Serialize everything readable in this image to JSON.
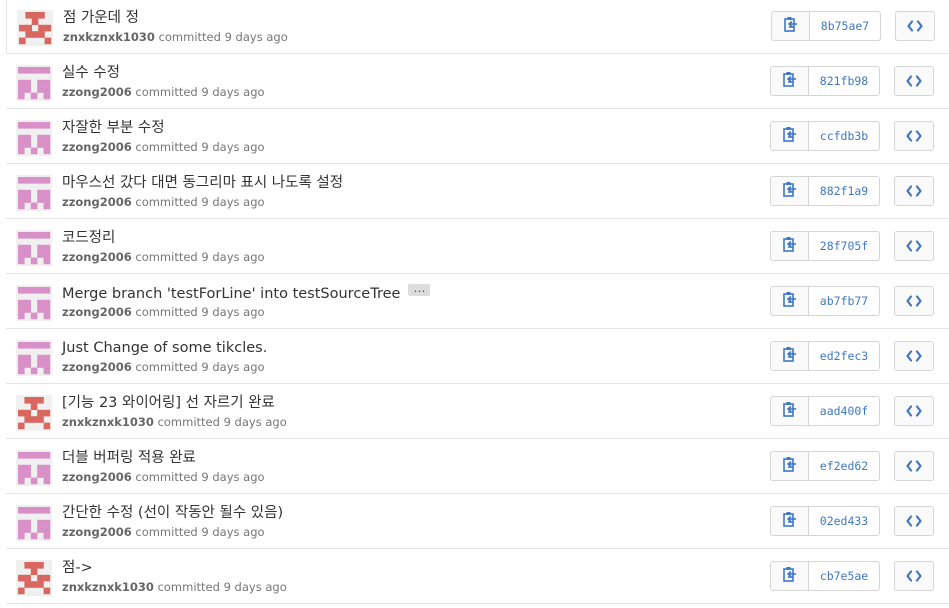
{
  "commits": [
    {
      "title": "점 가운데 정",
      "author": "znxkznxk1030",
      "time": "committed 9 days ago",
      "sha": "8b75ae7",
      "avatar": "red",
      "has_ellipsis": false
    },
    {
      "title": "실수 수정",
      "author": "zzong2006",
      "time": "committed 9 days ago",
      "sha": "821fb98",
      "avatar": "pink",
      "has_ellipsis": false
    },
    {
      "title": "자잘한 부분 수정",
      "author": "zzong2006",
      "time": "committed 9 days ago",
      "sha": "ccfdb3b",
      "avatar": "pink",
      "has_ellipsis": false
    },
    {
      "title": "마우스선 갔다 대면 동그리마 표시 나도록 설정",
      "author": "zzong2006",
      "time": "committed 9 days ago",
      "sha": "882f1a9",
      "avatar": "pink",
      "has_ellipsis": false
    },
    {
      "title": "코드정리",
      "author": "zzong2006",
      "time": "committed 9 days ago",
      "sha": "28f705f",
      "avatar": "pink",
      "has_ellipsis": false
    },
    {
      "title": "Merge branch 'testForLine' into testSourceTree",
      "author": "zzong2006",
      "time": "committed 9 days ago",
      "sha": "ab7fb77",
      "avatar": "pink",
      "has_ellipsis": true
    },
    {
      "title": "Just Change of some tikcles.",
      "author": "zzong2006",
      "time": "committed 9 days ago",
      "sha": "ed2fec3",
      "avatar": "pink",
      "has_ellipsis": false
    },
    {
      "title": "[기능 23 와이어링] 선 자르기 완료",
      "author": "znxkznxk1030",
      "time": "committed 9 days ago",
      "sha": "aad400f",
      "avatar": "red",
      "has_ellipsis": false
    },
    {
      "title": "더블 버퍼링 적용 완료",
      "author": "zzong2006",
      "time": "committed 9 days ago",
      "sha": "ef2ed62",
      "avatar": "pink",
      "has_ellipsis": false
    },
    {
      "title": "간단한 수정 (선이 작동안 될수 있음)",
      "author": "zzong2006",
      "time": "committed 9 days ago",
      "sha": "02ed433",
      "avatar": "pink",
      "has_ellipsis": false
    },
    {
      "title": "점->",
      "author": "znxkznxk1030",
      "time": "committed 9 days ago",
      "sha": "cb7e5ae",
      "avatar": "red",
      "has_ellipsis": false
    }
  ],
  "ellipsis_label": "…",
  "colors": {
    "avatar_red": "#d9675f",
    "avatar_pink": "#d98fc7",
    "sha_link": "#4078c0",
    "icon": "#4078c0",
    "row_border": "#e5e5e5"
  },
  "icons": {
    "copy": "clipboard-icon",
    "browse": "code-icon"
  }
}
